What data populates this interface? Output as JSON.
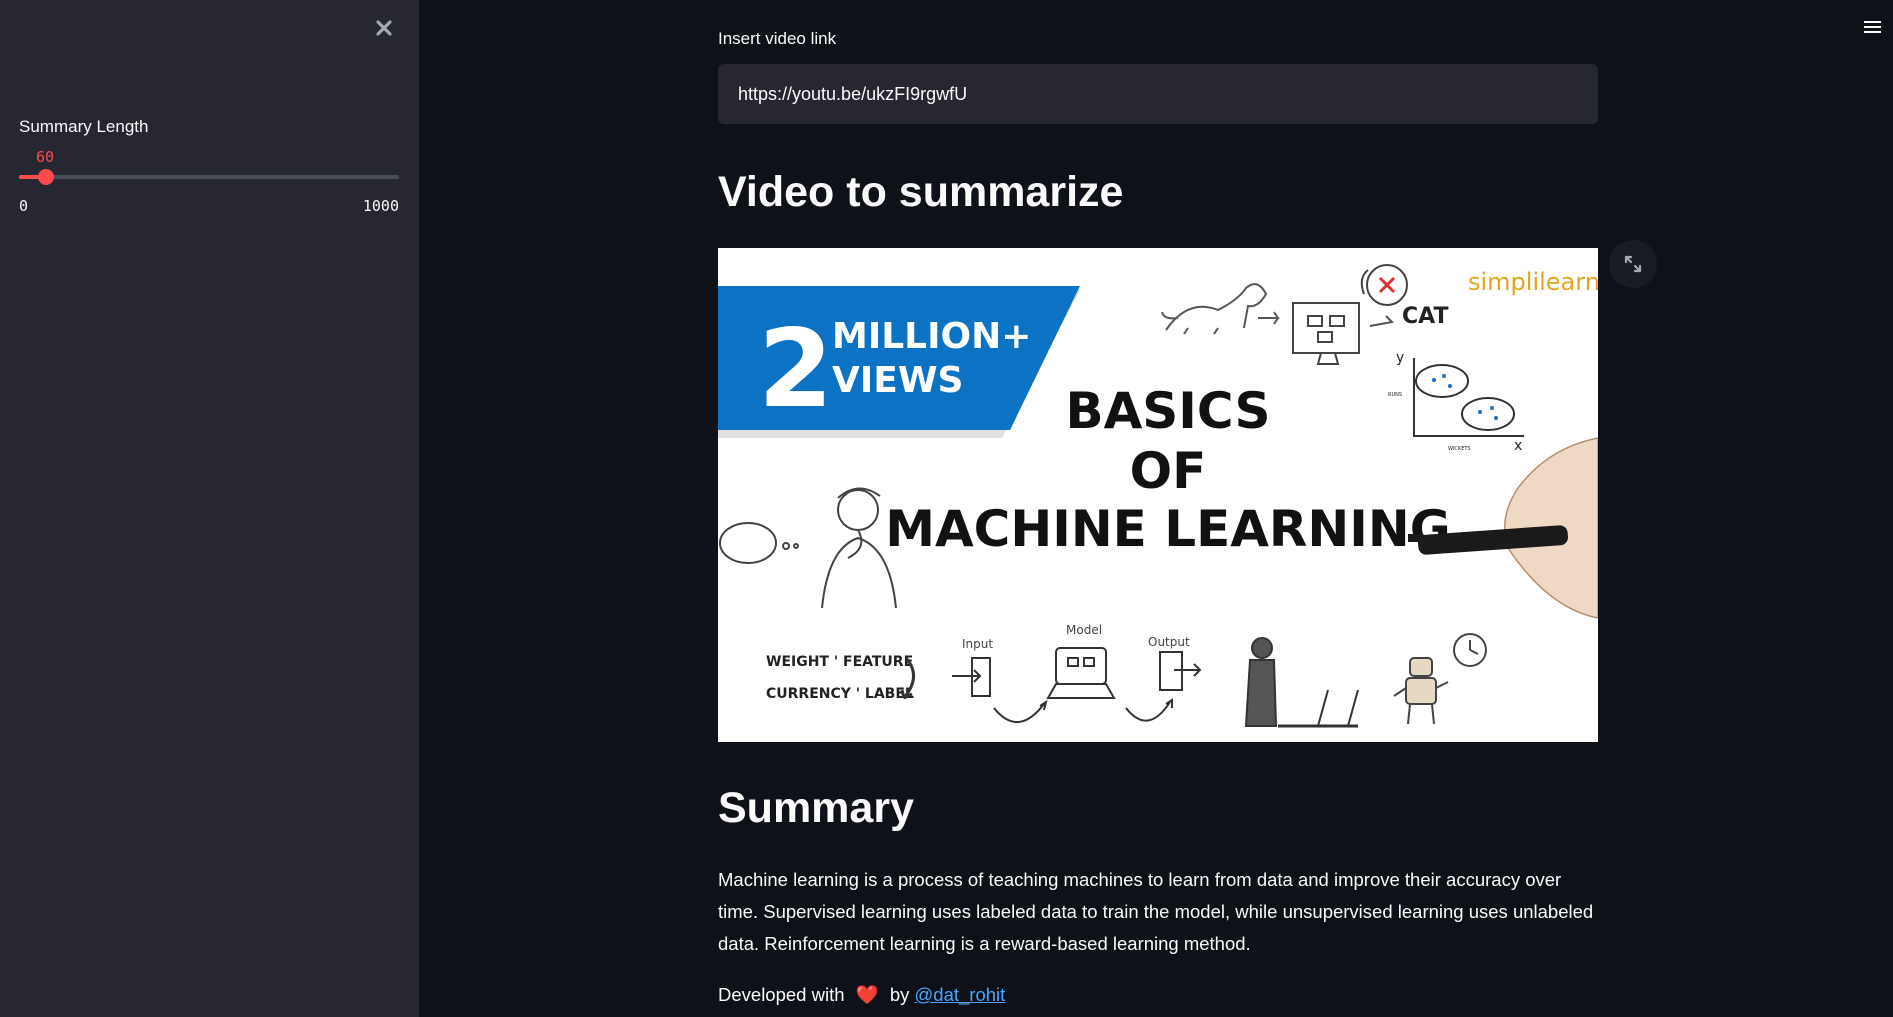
{
  "sidebar": {
    "close_icon": "close-icon",
    "slider": {
      "label": "Summary Length",
      "value": 60,
      "min": 0,
      "max": 1000,
      "min_label": "0",
      "max_label": "1000",
      "value_label": "60",
      "accent_color": "#ff4b4b"
    }
  },
  "header": {
    "menu_icon": "hamburger-menu-icon"
  },
  "main": {
    "input": {
      "label": "Insert video link",
      "value": "https://youtu.be/ukzFI9rgwfU"
    },
    "video_heading": "Video to summarize",
    "thumbnail": {
      "badge_number": "2",
      "badge_line1": "MILLION+",
      "badge_line2": "VIEWS",
      "title_line1": "BASICS",
      "title_line2": "OF",
      "title_line3": "MACHINE LEARNING",
      "brand": "simplilearn",
      "label_cat": "CAT",
      "label_y": "y",
      "label_x": "x",
      "label_runs": "RUNS",
      "label_wickets": "WICKETS",
      "label_weight_feature": "WEIGHT ' FEATURE",
      "label_currency_label": "CURRENCY ' LABEL",
      "label_input": "Input",
      "label_model": "Model",
      "label_output": "Output",
      "badge_color": "#0b72c4"
    },
    "expand_icon": "fullscreen-expand-icon",
    "summary_heading": "Summary",
    "summary_text": "Machine learning is a process of teaching machines to learn from data and improve their accuracy over time. Supervised learning uses labeled data to train the model, while unsupervised learning uses unlabeled data. Reinforcement learning is a reward-based learning method.",
    "footer": {
      "prefix": "Developed with",
      "heart": "❤️",
      "by": "by",
      "author_link": "@dat_rohit"
    }
  },
  "colors": {
    "background": "#0e1117",
    "sidebar": "#262730",
    "input_bg": "#262730",
    "text": "#fafafa",
    "link": "#4da3ff"
  }
}
